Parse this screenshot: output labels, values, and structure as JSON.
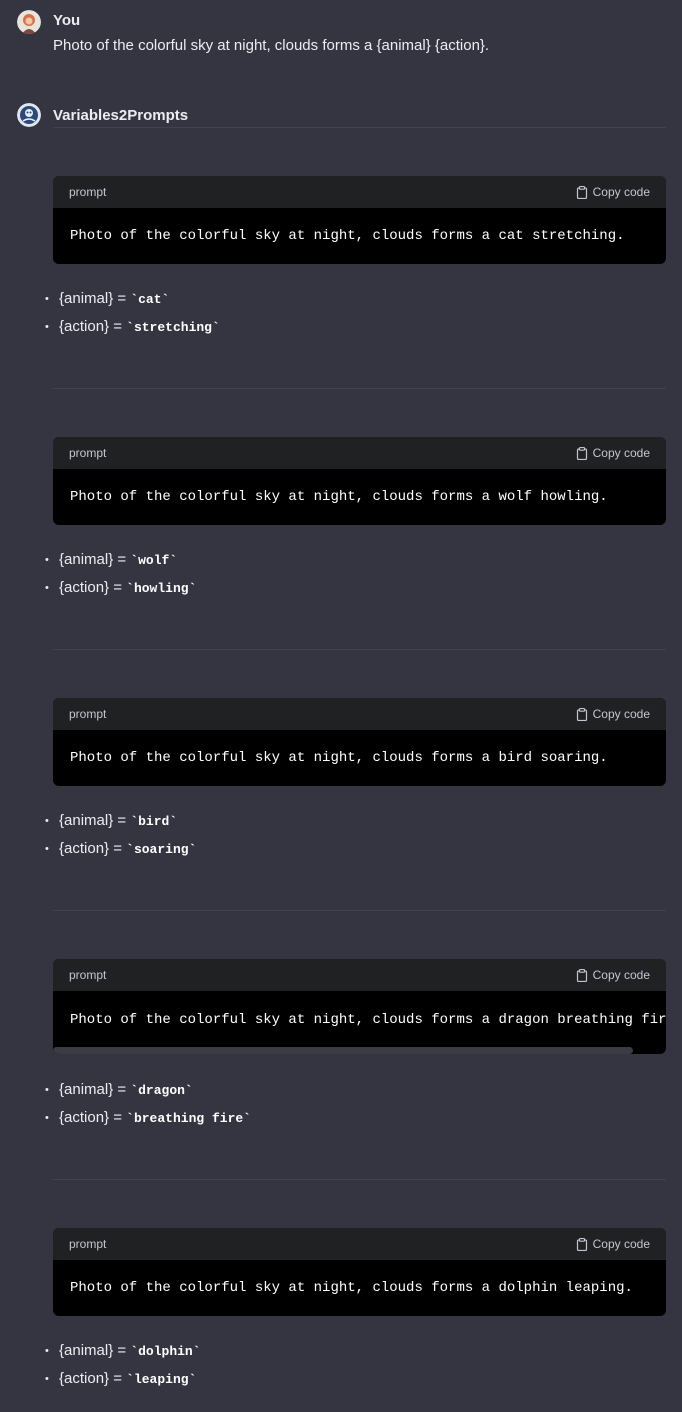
{
  "user": {
    "name": "You",
    "message": "Photo of the colorful sky at night, clouds forms a {animal} {action}."
  },
  "assistant": {
    "name": "Variables2Prompts"
  },
  "copy_label": "Copy code",
  "lang_label": "prompt",
  "responses": [
    {
      "code": "Photo of the colorful sky at night, clouds forms a cat stretching.",
      "var1_key": "{animal} = ",
      "var1_val": "`cat`",
      "var2_key": "{action} = ",
      "var2_val": "`stretching`"
    },
    {
      "code": "Photo of the colorful sky at night, clouds forms a wolf howling.",
      "var1_key": "{animal} = ",
      "var1_val": "`wolf`",
      "var2_key": "{action} = ",
      "var2_val": "`howling`"
    },
    {
      "code": "Photo of the colorful sky at night, clouds forms a bird soaring.",
      "var1_key": "{animal} = ",
      "var1_val": "`bird`",
      "var2_key": "{action} = ",
      "var2_val": "`soaring`"
    },
    {
      "code": "Photo of the colorful sky at night, clouds forms a dragon breathing fire.",
      "var1_key": "{animal} = ",
      "var1_val": "`dragon`",
      "var2_key": "{action} = ",
      "var2_val": "`breathing fire`"
    },
    {
      "code": "Photo of the colorful sky at night, clouds forms a dolphin leaping.",
      "var1_key": "{animal} = ",
      "var1_val": "`dolphin`",
      "var2_key": "{action} = ",
      "var2_val": "`leaping`"
    }
  ],
  "colors": {
    "background": "#343541",
    "code_header": "#202123",
    "code_body": "#000000",
    "text": "#ececf1"
  }
}
